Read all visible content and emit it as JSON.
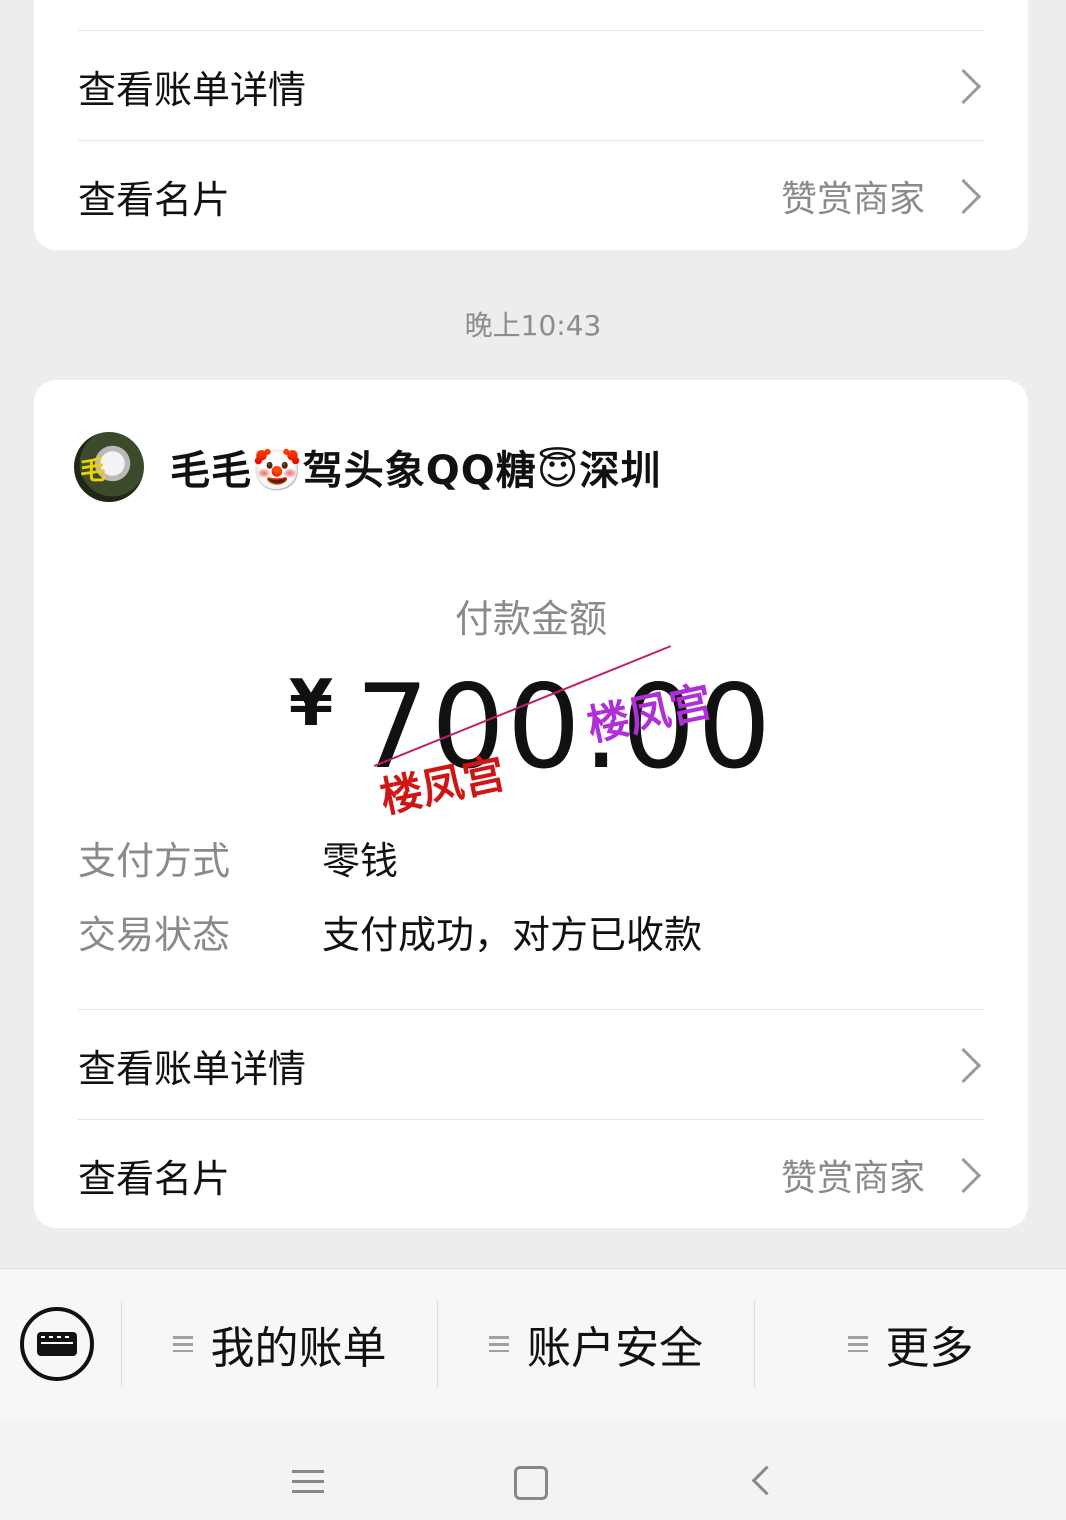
{
  "top_card": {
    "bill_details": "查看账单详情",
    "view_card": "查看名片",
    "reward_merchant": "赞赏商家"
  },
  "timestamp": "晚上10:43",
  "main_card": {
    "merchant_name": "毛毛🤡驾头象QQ糖😇深圳",
    "amount_caption": "付款金额",
    "currency": "¥",
    "amount": "700.00",
    "watermark_1": "楼凤宫",
    "watermark_2": "楼凤宫",
    "payment_method_label": "支付方式",
    "payment_method_value": "零钱",
    "status_label": "交易状态",
    "status_value": "支付成功，对方已收款",
    "bill_details": "查看账单详情",
    "view_card": "查看名片",
    "reward_merchant": "赞赏商家"
  },
  "bottom_menu": {
    "items": [
      {
        "label": "我的账单"
      },
      {
        "label": "账户安全"
      },
      {
        "label": "更多"
      }
    ]
  },
  "icons": {
    "keyboard": "keyboard-icon",
    "nav_menu": "menu-icon",
    "nav_home": "home-icon",
    "nav_back": "back-icon"
  }
}
